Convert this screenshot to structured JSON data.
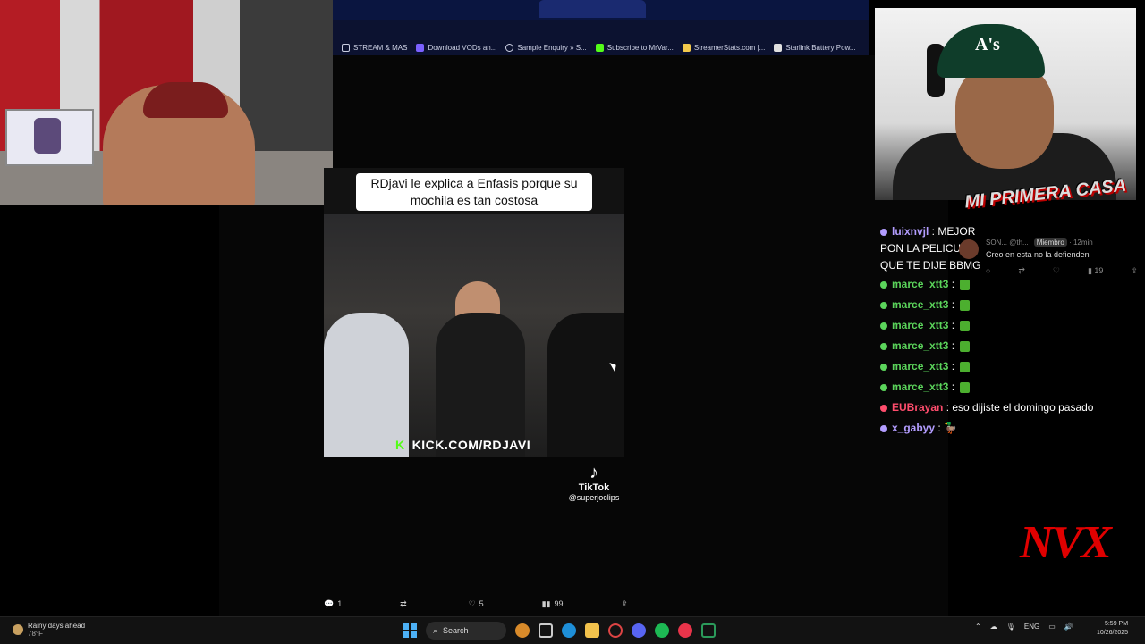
{
  "browser": {
    "bookmarks": [
      {
        "label": "STREAM & MAS",
        "icon": "folder-icon",
        "color": "#c9cde0"
      },
      {
        "label": "Download VODs an...",
        "icon": "page-icon",
        "color": "#7b61ff"
      },
      {
        "label": "Sample Enquiry » S...",
        "icon": "globe-icon",
        "color": "#cfd3e6"
      },
      {
        "label": "Subscribe to MrVar...",
        "icon": "kick-icon",
        "color": "#53fc18"
      },
      {
        "label": "StreamerStats.com |...",
        "icon": "chart-icon",
        "color": "#f2c94c"
      },
      {
        "label": "Starlink Battery Pow...",
        "icon": "page-icon",
        "color": "#e0e0e0"
      }
    ]
  },
  "video": {
    "caption": "RDjavi le explica a Enfasis porque su mochila es tan costosa",
    "watermark": "KICK.COM/RDJAVI",
    "kick_logo": "K",
    "tiktok_name": "TikTok",
    "tiktok_handle": "@superjoclips"
  },
  "tweet_actions": {
    "replies": "1",
    "retweets": "",
    "likes": "5",
    "views": "99"
  },
  "overlay": {
    "title": "MI PRIMERA CASA",
    "logo": "NVX"
  },
  "chat": {
    "messages": [
      {
        "user": "luixnvjl",
        "user_color": "#b39dff",
        "text": "MEJOR PON LA PELICULA QUE TE DIJE BBMG",
        "emote": false
      },
      {
        "user": "marce_xtt3",
        "user_color": "#5bd45b",
        "text": "",
        "emote": true
      },
      {
        "user": "marce_xtt3",
        "user_color": "#5bd45b",
        "text": "",
        "emote": true
      },
      {
        "user": "marce_xtt3",
        "user_color": "#5bd45b",
        "text": "",
        "emote": true
      },
      {
        "user": "marce_xtt3",
        "user_color": "#5bd45b",
        "text": "",
        "emote": true
      },
      {
        "user": "marce_xtt3",
        "user_color": "#5bd45b",
        "text": "",
        "emote": true
      },
      {
        "user": "marce_xtt3",
        "user_color": "#5bd45b",
        "text": "",
        "emote": true
      },
      {
        "user": "EUBrayan",
        "user_color": "#ff4d6d",
        "text": "eso dijiste el domingo pasado",
        "emote": false
      },
      {
        "user": "x_gabyy",
        "user_color": "#b39dff",
        "text": "🦆",
        "emote": false
      }
    ]
  },
  "reply_popup": {
    "author": "SON...",
    "handle": "@th...",
    "badge": "Miembro",
    "time": "12min",
    "text": "Creo  en esta no la defienden",
    "views": "19"
  },
  "taskbar": {
    "weather_title": "Rainy days ahead",
    "weather_temp": "78°F",
    "search": "Search",
    "lang": "ENG",
    "time": "5:59 PM",
    "date": "10/26/2025"
  }
}
